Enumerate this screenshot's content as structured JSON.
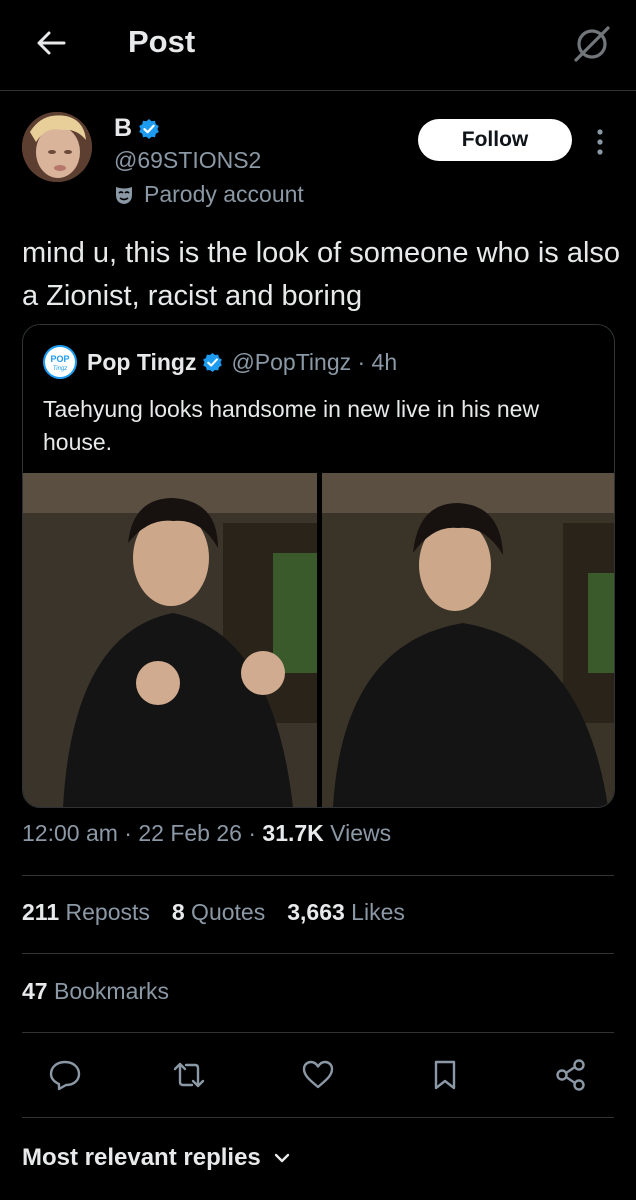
{
  "header": {
    "title": "Post"
  },
  "author": {
    "display_name": "B",
    "handle": "@69STIONS2",
    "label": "Parody account"
  },
  "follow_label": "Follow",
  "post": {
    "text": "mind u, this is the look of someone who is also a Zionist, racist and boring"
  },
  "quote": {
    "display_name": "Pop Tingz",
    "handle_time": "@PopTingz · 4h",
    "avatar_text": "POP Tingz",
    "text": "Taehyung looks handsome in new live in his new house."
  },
  "meta": {
    "time": "12:00 am",
    "sep1": " · ",
    "date": "22 Feb 26",
    "sep2": " · ",
    "views_count": "31.7K",
    "views_label": " Views"
  },
  "stats": {
    "reposts_count": "211",
    "reposts_label": " Reposts",
    "quotes_count": "8",
    "quotes_label": " Quotes",
    "likes_count": "3,663",
    "likes_label": " Likes",
    "bookmarks_count": "47",
    "bookmarks_label": " Bookmarks"
  },
  "replies_sort": {
    "label": "Most relevant replies"
  },
  "icons": {
    "back": "arrow-left-icon",
    "grok": "grok-icon",
    "more": "more-vertical-icon",
    "verified": "verified-badge-icon",
    "parody": "mask-icon",
    "reply": "reply-icon",
    "repost": "repost-icon",
    "like": "heart-icon",
    "bookmark": "bookmark-icon",
    "share": "share-icon",
    "chevron": "chevron-down-icon"
  },
  "colors": {
    "background": "#000000",
    "text": "#e7e9ea",
    "secondary": "#8b98a5",
    "accent": "#1d9bf0",
    "border": "#2f3336"
  }
}
